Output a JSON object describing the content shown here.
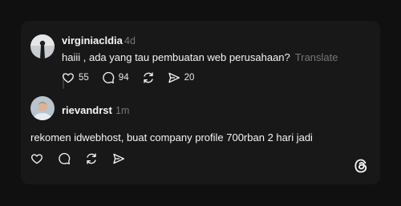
{
  "post": {
    "username": "virginiacldia",
    "time": "4d",
    "text": "haiii , ada yang tau pembuatan web perusahaan?",
    "translate_label": "Translate",
    "likes": "55",
    "replies": "94",
    "shares": "20"
  },
  "reply": {
    "username": "rievandrst",
    "time": "1m",
    "text": "rekomen idwebhost, buat company profile 700rban 2 hari jadi"
  },
  "icons": {
    "like": "heart-icon",
    "comment": "comment-icon",
    "repost": "repost-icon",
    "share": "send-icon",
    "brand": "threads-logo"
  },
  "colors": {
    "page_bg": "#101010",
    "card_bg": "#181818",
    "text": "#f3f5f7",
    "muted": "#777777"
  }
}
